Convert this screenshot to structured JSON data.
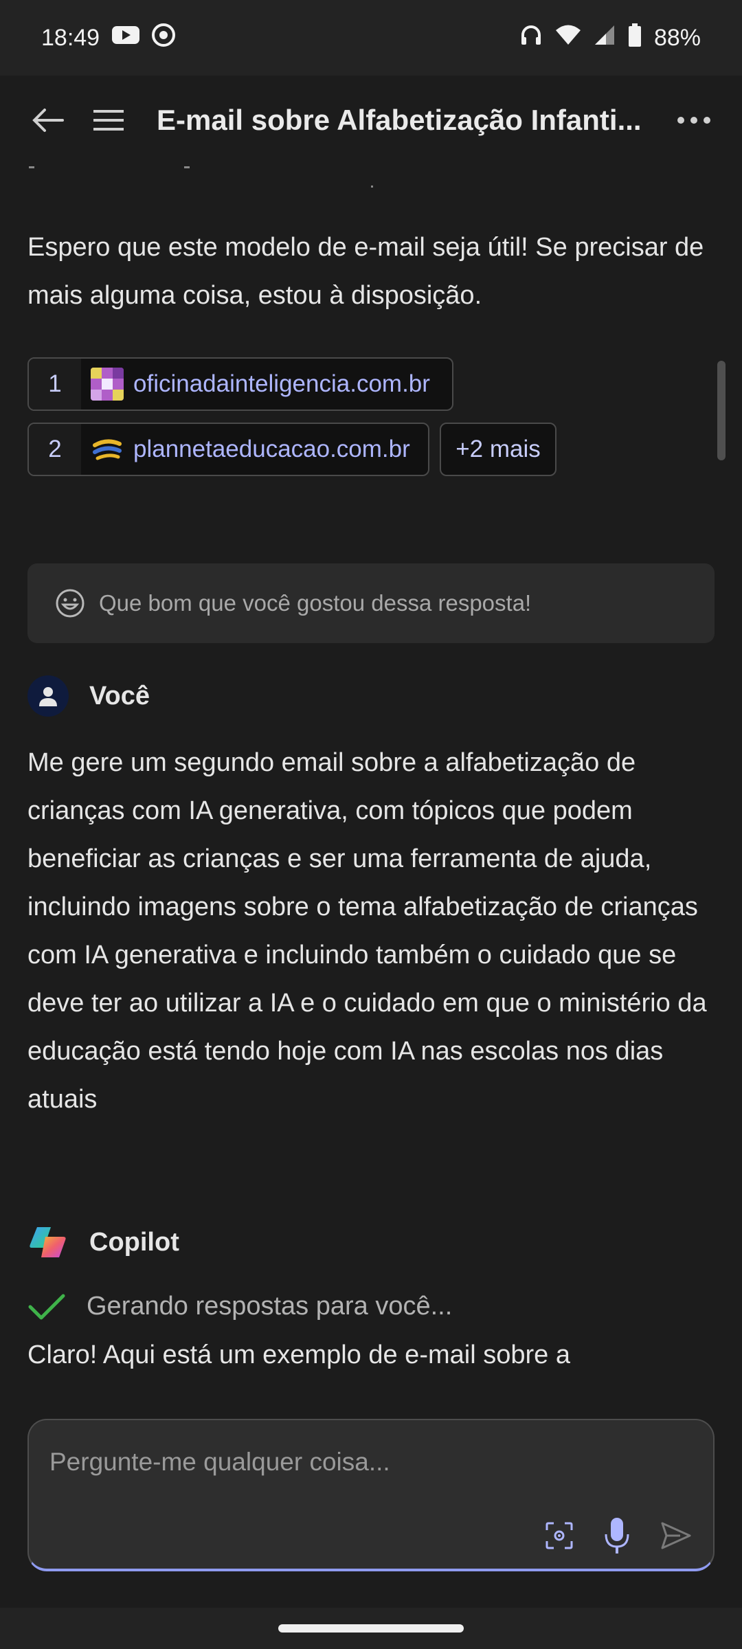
{
  "status_bar": {
    "time": "18:49",
    "battery": "88%"
  },
  "app_bar": {
    "title": "E-mail sobre Alfabetização Infanti..."
  },
  "chat": {
    "closing_text": "Espero que este modelo de e-mail seja útil! Se precisar de mais alguma coisa, estou à disposição.",
    "sources": [
      {
        "num": "1",
        "site": "oficinadainteligencia.com.br"
      },
      {
        "num": "2",
        "site": "plannetaeducacao.com.br"
      }
    ],
    "more_sources": "+2 mais",
    "feedback": "Que bom que você gostou dessa resposta!",
    "user": {
      "name": "Você",
      "message": "Me gere um segundo email sobre a alfabetização de crianças com IA generativa, com tópicos que podem beneficiar as crianças e ser uma ferramenta de ajuda, incluindo imagens sobre o tema alfabetização de crianças com IA generativa e incluindo também o cuidado que se deve ter ao utilizar a IA e o cuidado em que o ministério da educação está tendo hoje com IA nas escolas nos dias atuais"
    },
    "assistant": {
      "name": "Copilot",
      "status": "Gerando respostas para você...",
      "partial": "Claro! Aqui está um exemplo de e-mail sobre a"
    }
  },
  "input": {
    "placeholder": "Pergunte-me qualquer coisa..."
  },
  "colors": {
    "accent": "#aeb6ff",
    "check": "#3fb24a"
  }
}
